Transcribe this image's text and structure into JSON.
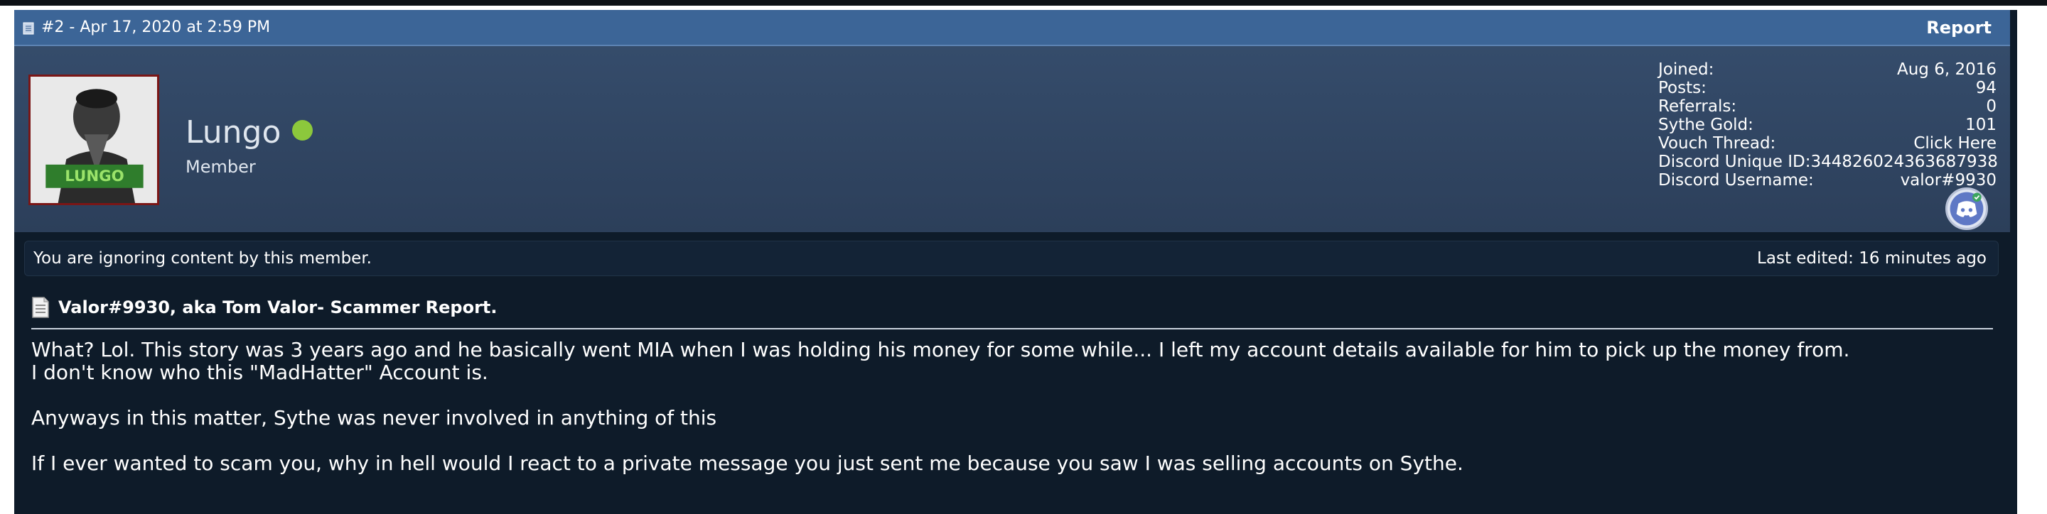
{
  "post": {
    "number_date": "#2 - Apr 17, 2020 at 2:59 PM",
    "report_label": "Report"
  },
  "user": {
    "name": "Lungo",
    "role": "Member",
    "online_color": "#8cc83c",
    "avatar_text": "LUNGO"
  },
  "stats": [
    {
      "label": "Joined:",
      "value": "Aug 6, 2016"
    },
    {
      "label": "Posts:",
      "value": "94"
    },
    {
      "label": "Referrals:",
      "value": "0"
    },
    {
      "label": "Sythe Gold:",
      "value": "101"
    },
    {
      "label": "Vouch Thread:",
      "value": "Click Here"
    },
    {
      "label": "Discord Unique ID:",
      "value": "344826024363687938"
    },
    {
      "label": "Discord Username:",
      "value": "valor#9930"
    }
  ],
  "notice": {
    "ignoring": "You are ignoring content by this member.",
    "last_edited": "Last edited: 16 minutes ago"
  },
  "thread": {
    "title": "Valor#9930, aka Tom Valor- Scammer Report."
  },
  "message": {
    "line1": "What? Lol. This story was 3 years ago and he basically went MIA when I was holding his money for some while... I left my account details available for him to pick up the money from.",
    "line2": "I don't know who this \"MadHatter\" Account is.",
    "line3": "Anyways in this matter, Sythe was never involved in anything of this",
    "line4": "If I ever wanted to scam you, why in hell would I react to a private message you just sent me because you saw I was selling accounts on Sythe."
  },
  "icons": {
    "post_icon": "document-icon",
    "title_icon": "page-icon",
    "discord_icon": "discord-icon",
    "online_icon": "online-dot-icon"
  }
}
